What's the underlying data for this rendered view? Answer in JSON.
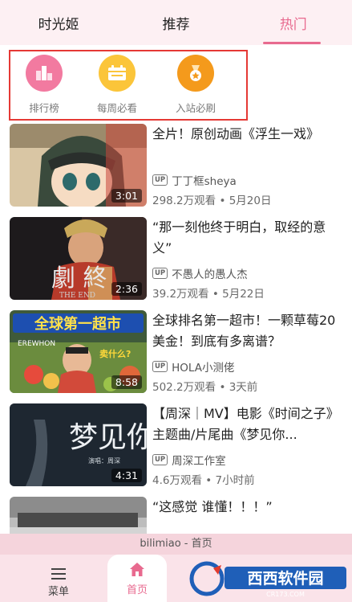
{
  "tabs": {
    "items": [
      {
        "label": "时光姬"
      },
      {
        "label": "推荐"
      },
      {
        "label": "热门"
      }
    ],
    "active_index": 2
  },
  "shortcuts": [
    {
      "label": "排行榜",
      "icon": "ranking-icon",
      "color": "#f27aa0"
    },
    {
      "label": "每周必看",
      "icon": "weekly-calendar-icon",
      "color": "#fbc53a"
    },
    {
      "label": "入站必刷",
      "icon": "medal-icon",
      "color": "#f49a1c"
    }
  ],
  "videos": [
    {
      "title": "全片！原创动画《浮生一戏》",
      "up_tag": "UP",
      "uploader": "丁丁框sheya",
      "meta": "298.2万观看 • 5月20日",
      "duration": "3:01",
      "thumb_caption": ""
    },
    {
      "title": "“那一刻他终于明白，取经的意义”",
      "up_tag": "UP",
      "uploader": "不愚人的愚人杰",
      "meta": "39.2万观看 • 5月22日",
      "duration": "2:36",
      "thumb_caption": "劇 終",
      "thumb_subcaption": "THE END"
    },
    {
      "title": "全球排名第一超市！一颗草莓20美金！到底有多离谱？",
      "up_tag": "UP",
      "uploader": "HOLA小测佬",
      "meta": "502.2万观看 • 3天前",
      "duration": "8:58",
      "thumb_caption": "全球第一超市",
      "thumb_subcaption": "卖什么?",
      "thumb_store": "EREWHON"
    },
    {
      "title": "【周深｜MV】电影《时间之子》主题曲/片尾曲《梦见你...",
      "up_tag": "UP",
      "uploader": "周深工作室",
      "meta": "4.6万观看 • 7小时前",
      "duration": "4:31",
      "thumb_caption": "梦见你",
      "thumb_subcaption": "演唱：周深"
    },
    {
      "title": "“这感觉 谁懂！！！”",
      "up_tag": "",
      "uploader": "",
      "meta": "",
      "duration": "",
      "thumb_caption": ""
    }
  ],
  "page_caption": "bilimiao - 首页",
  "bottom_nav": {
    "menu_label": "菜单",
    "home_label": "首页"
  },
  "watermark": {
    "brand": "西西软件园",
    "site": "CR173.COM"
  },
  "colors": {
    "accent": "#e86a8f",
    "highlight_border": "#e53935"
  }
}
